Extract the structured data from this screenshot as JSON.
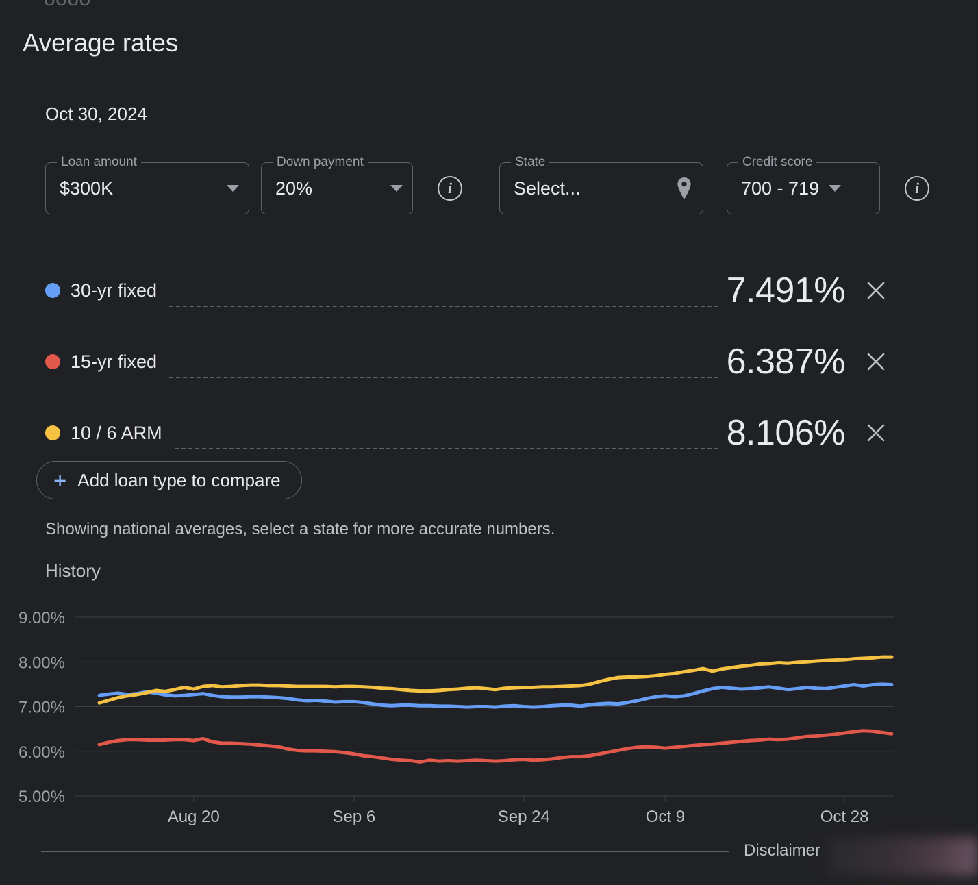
{
  "top_clipped_text": "oooo",
  "header": {
    "title": "Average rates",
    "date": "Oct 30, 2024"
  },
  "controls": [
    {
      "name": "loan-amount",
      "label": "Loan amount",
      "value": "$300K",
      "icon": "chevron-down-icon"
    },
    {
      "name": "down-payment",
      "label": "Down payment",
      "value": "20%",
      "icon": "chevron-down-icon"
    },
    {
      "name": "state",
      "label": "State",
      "value": "Select...",
      "icon": "location-pin-icon"
    },
    {
      "name": "credit-score",
      "label": "Credit score",
      "value": "700 - 719",
      "icon": "chevron-down-icon"
    }
  ],
  "info_icon": "info-icon",
  "rates": [
    {
      "label": "30-yr fixed",
      "value": "7.491%",
      "color": "#669df6",
      "remove": "close-icon"
    },
    {
      "label": "15-yr fixed",
      "value": "6.387%",
      "color": "#e2594c",
      "remove": "close-icon"
    },
    {
      "label": "10 / 6 ARM",
      "value": "8.106%",
      "color": "#f5c councils"
    }
  ],
  "add_button": {
    "plus": "+",
    "label": "Add loan type to compare"
  },
  "note": "Showing national averages, select a state for more accurate numbers.",
  "history_label": "History",
  "footer": {
    "disclaimer": "Disclaimer"
  },
  "chart_data": {
    "type": "line",
    "title": "History",
    "xlabel": "",
    "ylabel": "",
    "ylim": [
      5.0,
      9.0
    ],
    "ytick_labels": [
      "9.00%",
      "8.00%",
      "7.00%",
      "6.00%",
      "5.00%"
    ],
    "yticks": [
      9.0,
      8.0,
      7.0,
      6.0,
      5.0
    ],
    "xtick_labels": [
      "Aug 20",
      "Sep 6",
      "Sep 24",
      "Oct 9",
      "Oct 28"
    ],
    "xtick_positions": [
      10,
      27,
      45,
      60,
      79
    ],
    "grid": true,
    "legend_position": "above-chart",
    "series": [
      {
        "name": "30-yr fixed",
        "color": "#669df6",
        "values": [
          7.25,
          7.28,
          7.3,
          7.27,
          7.29,
          7.33,
          7.3,
          7.26,
          7.24,
          7.25,
          7.27,
          7.29,
          7.25,
          7.22,
          7.21,
          7.21,
          7.22,
          7.22,
          7.21,
          7.2,
          7.18,
          7.15,
          7.13,
          7.14,
          7.12,
          7.1,
          7.11,
          7.11,
          7.09,
          7.06,
          7.03,
          7.02,
          7.03,
          7.03,
          7.02,
          7.02,
          7.01,
          7.01,
          7.0,
          6.99,
          7.0,
          7.0,
          6.99,
          7.01,
          7.02,
          7.0,
          6.99,
          7.0,
          7.02,
          7.03,
          7.03,
          7.01,
          7.04,
          7.06,
          7.07,
          7.06,
          7.09,
          7.13,
          7.18,
          7.22,
          7.24,
          7.22,
          7.24,
          7.29,
          7.35,
          7.4,
          7.43,
          7.41,
          7.39,
          7.4,
          7.42,
          7.44,
          7.41,
          7.38,
          7.4,
          7.43,
          7.41,
          7.4,
          7.43,
          7.46,
          7.49,
          7.46,
          7.49,
          7.5,
          7.49
        ]
      },
      {
        "name": "15-yr fixed",
        "color": "#e2594c",
        "values": [
          6.15,
          6.2,
          6.24,
          6.26,
          6.26,
          6.25,
          6.25,
          6.25,
          6.26,
          6.26,
          6.24,
          6.28,
          6.21,
          6.18,
          6.18,
          6.17,
          6.16,
          6.14,
          6.12,
          6.1,
          6.05,
          6.02,
          6.01,
          6.01,
          6.0,
          5.99,
          5.97,
          5.94,
          5.9,
          5.88,
          5.85,
          5.82,
          5.8,
          5.79,
          5.76,
          5.8,
          5.78,
          5.79,
          5.78,
          5.79,
          5.8,
          5.79,
          5.78,
          5.79,
          5.81,
          5.82,
          5.8,
          5.81,
          5.83,
          5.86,
          5.88,
          5.88,
          5.9,
          5.94,
          5.98,
          6.02,
          6.06,
          6.09,
          6.1,
          6.09,
          6.07,
          6.09,
          6.11,
          6.13,
          6.15,
          6.16,
          6.18,
          6.2,
          6.22,
          6.24,
          6.25,
          6.27,
          6.26,
          6.27,
          6.3,
          6.33,
          6.34,
          6.36,
          6.38,
          6.41,
          6.44,
          6.46,
          6.45,
          6.42,
          6.39
        ]
      },
      {
        "name": "10 / 6 ARM",
        "color": "#f5c243",
        "values": [
          7.08,
          7.14,
          7.2,
          7.24,
          7.27,
          7.31,
          7.36,
          7.34,
          7.38,
          7.43,
          7.39,
          7.45,
          7.47,
          7.44,
          7.45,
          7.47,
          7.48,
          7.48,
          7.47,
          7.47,
          7.46,
          7.45,
          7.45,
          7.45,
          7.45,
          7.44,
          7.45,
          7.45,
          7.44,
          7.43,
          7.41,
          7.4,
          7.38,
          7.36,
          7.35,
          7.35,
          7.36,
          7.38,
          7.39,
          7.41,
          7.42,
          7.4,
          7.38,
          7.41,
          7.42,
          7.43,
          7.43,
          7.44,
          7.44,
          7.45,
          7.46,
          7.47,
          7.5,
          7.56,
          7.61,
          7.65,
          7.66,
          7.66,
          7.67,
          7.69,
          7.72,
          7.74,
          7.78,
          7.81,
          7.85,
          7.79,
          7.84,
          7.87,
          7.9,
          7.92,
          7.95,
          7.96,
          7.98,
          7.97,
          7.99,
          8.0,
          8.02,
          8.03,
          8.04,
          8.05,
          8.07,
          8.08,
          8.09,
          8.11,
          8.11
        ]
      }
    ]
  }
}
